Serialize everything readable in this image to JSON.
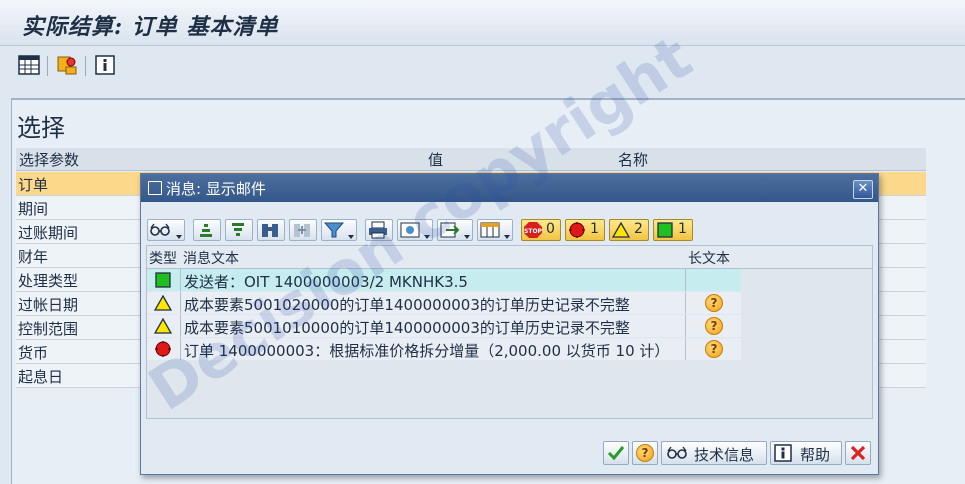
{
  "title": "实际结算: 订单 基本清单",
  "main": {
    "section_title": "选择",
    "columns": [
      "选择参数",
      "值",
      "名称"
    ],
    "params": [
      "订单",
      "期间",
      "过账期间",
      "财年",
      "处理类型",
      "过帐日期",
      "控制范围",
      "货币",
      "起息日"
    ]
  },
  "dialog": {
    "title": "消息: 显示邮件",
    "counts": {
      "stop": "0",
      "error": "1",
      "warning": "2",
      "success": "1"
    },
    "headers": {
      "type": "类型",
      "text": "消息文本",
      "longtext": "长文本"
    },
    "messages": [
      {
        "type": "success",
        "text": "发送者：OIT 1400000003/2 MKNHK3.5",
        "has_longtext": false
      },
      {
        "type": "warning",
        "text": "成本要素5001020000的订单1400000003的订单历史记录不完整",
        "has_longtext": true
      },
      {
        "type": "warning",
        "text": "成本要素5001010000的订单1400000003的订单历史记录不完整",
        "has_longtext": true
      },
      {
        "type": "error",
        "text": "订单 1400000003：根据标准价格拆分增量（2,000.00 以货币 10 计）",
        "has_longtext": true
      }
    ],
    "buttons": {
      "tech_info": "技术信息",
      "help": "帮助"
    }
  },
  "watermark": "Decision copyright",
  "colors": {
    "title_bar": "#3a5d8f",
    "selected_row": "#fbd88a",
    "highlight_row": "#c6ecef"
  }
}
